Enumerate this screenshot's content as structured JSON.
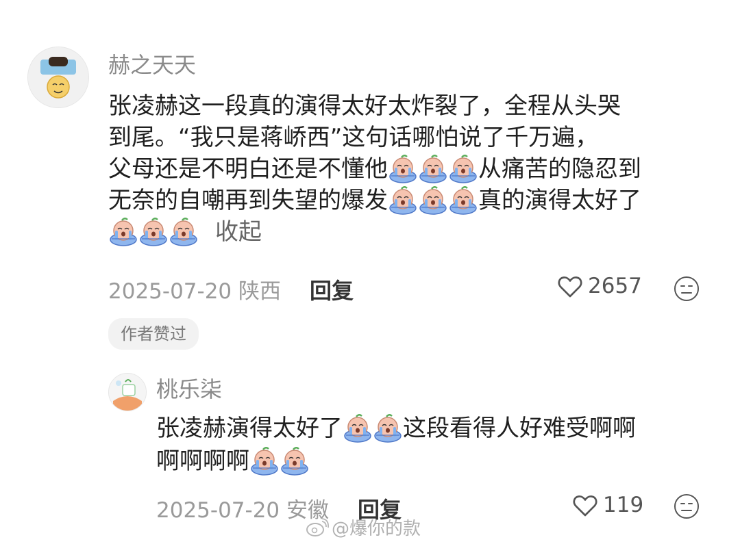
{
  "comment": {
    "username": "赫之天天",
    "lines": [
      "张凌赫这一段真的演得太好太炸裂了，全程从头哭",
      "到尾。“我只是蒋峤西”这句话哪怕说了千万遍，",
      [
        "父母还是不明白还是不懂他",
        "从痛苦的隐忍到"
      ],
      [
        "无奈的自嘲再到失望的爆发",
        "真的演得太好了"
      ]
    ],
    "collapse_label": "收起",
    "date": "2025-07-20",
    "location": "陕西",
    "reply_label": "回复",
    "likes": "2657",
    "author_badge": "作者赞过"
  },
  "reply": {
    "username": "桃乐柒",
    "line1_a": "张凌赫演得太好了",
    "line1_b": "这段看得人好难受啊啊",
    "line2": "啊啊啊啊",
    "date": "2025-07-20",
    "location": "安徽",
    "reply_label": "回复",
    "likes": "119"
  },
  "icons": {
    "emoji": "crying-emoji-icon",
    "like": "heart-icon",
    "more": "neutral-face-icon",
    "watermark": "weibo-icon"
  },
  "watermark_text": "@爆你的款",
  "colors": {
    "text": "#1f1f1f",
    "username": "#8a8a8a",
    "meta": "#9a9a9a",
    "badge_bg": "#f2f2f2"
  }
}
